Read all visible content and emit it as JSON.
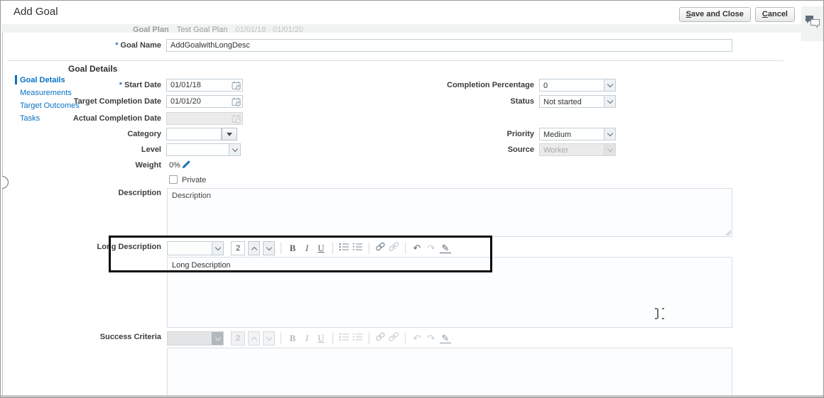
{
  "header": {
    "title": "Add Goal",
    "save_button": {
      "key": "S",
      "rest": "ave and Close"
    },
    "cancel_button": {
      "key": "C",
      "rest": "ancel"
    }
  },
  "background_page": {
    "goal_plan_label": "Goal Plan",
    "goal_plan_name": "Test Goal Plan",
    "goal_plan_dates": "01/01/18 - 01/01/20"
  },
  "goal_name": {
    "required": "*",
    "label": "Goal Name",
    "value": "AddGoalwithLongDesc"
  },
  "section_title": "Goal Details",
  "sidebar": {
    "items": [
      {
        "label": "Goal Details",
        "active": true
      },
      {
        "label": "Measurements",
        "active": false
      },
      {
        "label": "Target Outcomes",
        "active": false
      },
      {
        "label": "Tasks",
        "active": false
      }
    ]
  },
  "fields": {
    "start_date": {
      "required": "*",
      "label": "Start Date",
      "value": "01/01/18"
    },
    "target_completion_date": {
      "label": "Target Completion Date",
      "value": "01/01/20"
    },
    "actual_completion_date": {
      "label": "Actual Completion Date",
      "value": ""
    },
    "category": {
      "label": "Category",
      "value": ""
    },
    "level": {
      "label": "Level",
      "value": ""
    },
    "weight": {
      "label": "Weight",
      "value": "0%"
    },
    "private": {
      "label": "Private",
      "checked": false
    },
    "description": {
      "label": "Description",
      "value": "Description"
    },
    "long_description": {
      "label": "Long Description",
      "value": "Long Description"
    },
    "success_criteria": {
      "label": "Success Criteria",
      "value": ""
    },
    "completion_percentage": {
      "label": "Completion Percentage",
      "value": "0"
    },
    "status": {
      "label": "Status",
      "value": "Not started"
    },
    "priority": {
      "label": "Priority",
      "value": "Medium"
    },
    "source": {
      "label": "Source",
      "value": "Worker"
    }
  },
  "editor_toolbar": {
    "font_value": "",
    "font_size": "2",
    "bold": "B",
    "italic": "I",
    "underline": "U",
    "undo_glyph": "↶",
    "redo_glyph": "↷",
    "pencil_glyph": "✎"
  },
  "colors": {
    "accent_blue": "#0872c4",
    "required_marker": "#4a75b0",
    "highlight_border": "#0b0b0b",
    "field_border": "#c3cdd6",
    "disabled_bg": "#ebebeb"
  }
}
